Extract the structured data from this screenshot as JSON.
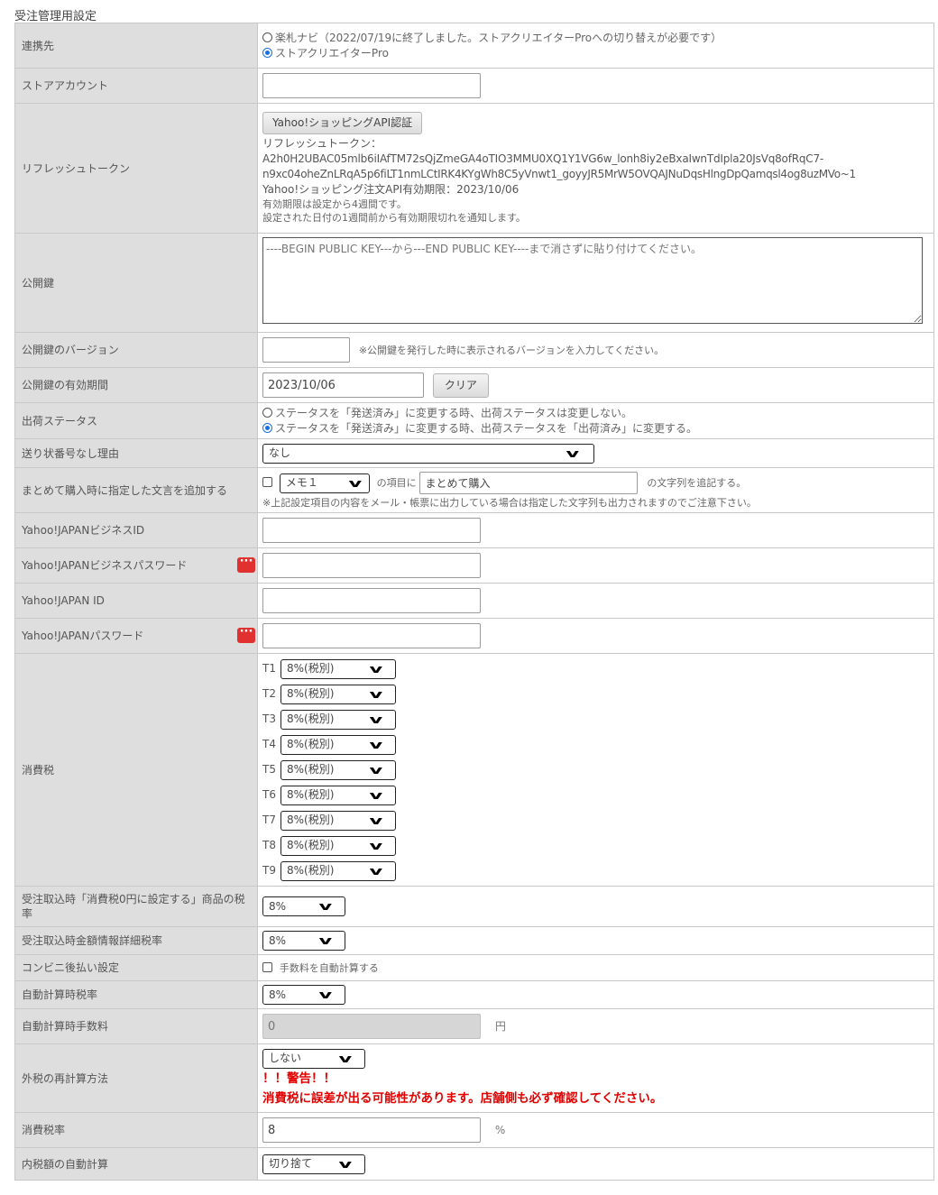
{
  "section_title": "受注管理用設定",
  "rows": {
    "link": {
      "label": "連携先",
      "option1": "楽札ナビ（2022/07/19に終了しました。ストアクリエイターProへの切り替えが必要です）",
      "option2": "ストアクリエイターPro",
      "selected": 2
    },
    "store_account": {
      "label": "ストアアカウント",
      "value": ""
    },
    "refresh_token": {
      "label": "リフレッシュトークン",
      "button": "Yahoo!ショッピングAPI認証",
      "token_label": "リフレッシュトークン：",
      "token_line1": "A2h0H2UBAC05mlb6iIAfTM72sQjZmeGA4oTIO3MMU0XQ1Y1VG6w_lonh8iy2eBxaIwnTdIpla20JsVq8ofRqC7-",
      "token_line2": "n9xc04oheZnLRqA5p6fiLT1nmLCtIRK4KYgWh8C5yVnwt1_goyyJR5MrW5OVQAJNuDqsHlngDpQamqsl4og8uzMVo~1",
      "expiry": "Yahoo!ショッピング注文API有効期限：2023/10/06",
      "note1": "有効期限は設定から4週間です。",
      "note2": "設定された日付の1週間前から有効期限切れを通知します。"
    },
    "public_key": {
      "label": "公開鍵",
      "placeholder": "----BEGIN PUBLIC KEY---から---END PUBLIC KEY----まで消さずに貼り付けてください。"
    },
    "public_key_version": {
      "label": "公開鍵のバージョン",
      "value": "",
      "note": "※公開鍵を発行した時に表示されるバージョンを入力してください。"
    },
    "public_key_expiry": {
      "label": "公開鍵の有効期間",
      "value": "2023/10/06",
      "button": "クリア"
    },
    "shipping_status": {
      "label": "出荷ステータス",
      "option1": "ステータスを「発送済み」に変更する時、出荷ステータスは変更しない。",
      "option2": "ステータスを「発送済み」に変更する時、出荷ステータスを「出荷済み」に変更する。",
      "selected": 2
    },
    "no_tracking_reason": {
      "label": "送り状番号なし理由",
      "value": "なし"
    },
    "combined_purchase": {
      "label": "まとめて購入時に指定した文言を追加する",
      "select": "メモ１",
      "text_mid": "の項目に",
      "value": "まとめて購入",
      "text_end": "の文字列を追記する。",
      "note": "※上記設定項目の内容をメール・帳票に出力している場合は指定した文字列も出力されますのでご注意下さい。"
    },
    "business_id": {
      "label": "Yahoo!JAPANビジネスID",
      "value": ""
    },
    "business_password": {
      "label": "Yahoo!JAPANビジネスパスワード",
      "value": ""
    },
    "yahoo_id": {
      "label": "Yahoo!JAPAN ID",
      "value": ""
    },
    "yahoo_password": {
      "label": "Yahoo!JAPANパスワード",
      "value": ""
    },
    "consumption_tax": {
      "label": "消費税",
      "items": [
        {
          "name": "T1",
          "value": "8%(税別)"
        },
        {
          "name": "T2",
          "value": "8%(税別)"
        },
        {
          "name": "T3",
          "value": "8%(税別)"
        },
        {
          "name": "T4",
          "value": "8%(税別)"
        },
        {
          "name": "T5",
          "value": "8%(税別)"
        },
        {
          "name": "T6",
          "value": "8%(税別)"
        },
        {
          "name": "T7",
          "value": "8%(税別)"
        },
        {
          "name": "T8",
          "value": "8%(税別)"
        },
        {
          "name": "T9",
          "value": "8%(税別)"
        }
      ]
    },
    "zero_tax_product_rate": {
      "label": "受注取込時「消費税0円に設定する」商品の税率",
      "value": "8%"
    },
    "amount_detail_tax_rate": {
      "label": "受注取込時金額情報詳細税率",
      "value": "8%"
    },
    "conveni_payment": {
      "label": "コンビニ後払い設定",
      "checkbox_label": "手数料を自動計算する"
    },
    "auto_calc_tax_rate": {
      "label": "自動計算時税率",
      "value": "8%"
    },
    "auto_calc_fee": {
      "label": "自動計算時手数料",
      "value": "0",
      "unit": "円"
    },
    "external_tax_method": {
      "label": "外税の再計算方法",
      "value": "しない",
      "warning1": "！！警告！！",
      "warning2": "消費税に誤差が出る可能性があります。店舗側も必ず確認してください。"
    },
    "tax_rate": {
      "label": "消費税率",
      "value": "8",
      "unit": "%"
    },
    "internal_tax_auto": {
      "label": "内税額の自動計算",
      "value": "切り捨て"
    }
  }
}
